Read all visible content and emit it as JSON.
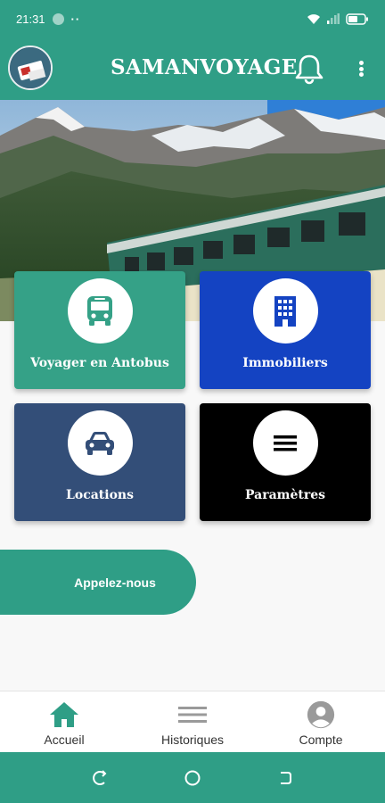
{
  "status_bar": {
    "time": "21:31",
    "dots": "··"
  },
  "app_bar": {
    "title": "SAMANVOYAGE",
    "notification_icon": "bell-icon",
    "menu_icon": "more-vert-icon"
  },
  "tiles": [
    {
      "label": "Voyager en Antobus",
      "icon": "bus-icon",
      "color": "#35a187"
    },
    {
      "label": "Immobiliers",
      "icon": "building-icon",
      "color": "#1443c2"
    },
    {
      "label": "Locations",
      "icon": "car-icon",
      "color": "#334e78"
    },
    {
      "label": "Paramètres",
      "icon": "menu-lines-icon",
      "color": "#000000"
    }
  ],
  "call_button": {
    "label": "Appelez-nous"
  },
  "bottom_nav": [
    {
      "label": "Accueil",
      "icon": "home-icon",
      "active": true
    },
    {
      "label": "Historiques",
      "icon": "list-icon",
      "active": false
    },
    {
      "label": "Compte",
      "icon": "account-icon",
      "active": false
    }
  ],
  "colors": {
    "primary": "#2f9e86",
    "blue": "#1443c2",
    "navy": "#334e78"
  }
}
